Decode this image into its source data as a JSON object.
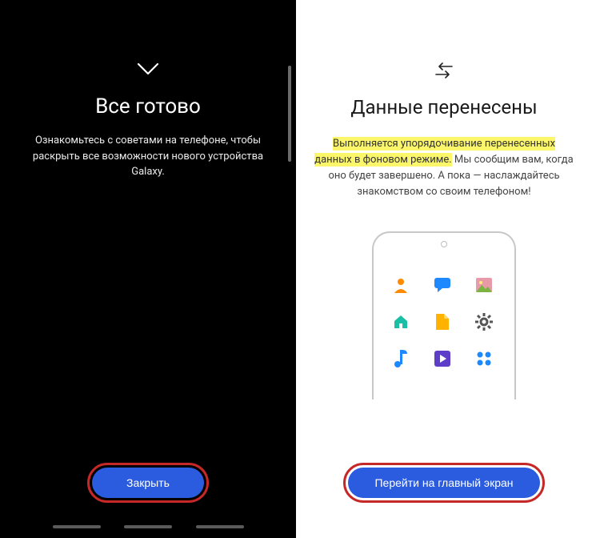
{
  "left": {
    "title": "Все готово",
    "body": "Ознакомьтесь с советами на телефоне, чтобы раскрыть все возможности нового устройства Galaxy.",
    "button": "Закрыть"
  },
  "right": {
    "title": "Данные перенесены",
    "highlight": "Выполняется упорядочивание перенесенных данных в фоновом режиме.",
    "body_rest": " Мы сообщим вам, когда оно будет завершено. А пока — наслаждайтесь знакомством со своим телефоном!",
    "button": "Перейти на главный экран"
  },
  "icons": {
    "chevron": "chevron-down",
    "transfer": "transfer-arrows",
    "grid": [
      "contact",
      "chat",
      "gallery",
      "home",
      "file",
      "settings",
      "music",
      "video",
      "apps"
    ]
  },
  "colors": {
    "accent": "#2b5ce0",
    "ring": "#c62828",
    "highlight": "#fcf76a"
  }
}
